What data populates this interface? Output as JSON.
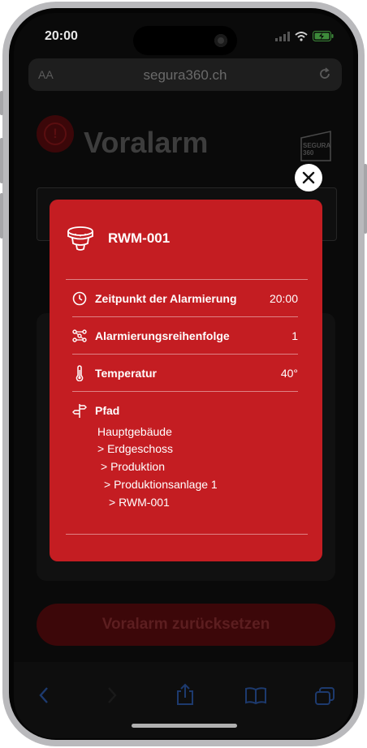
{
  "status_bar": {
    "time": "20:00"
  },
  "browser": {
    "text_size_button": "AA",
    "url": "segura360.ch"
  },
  "page": {
    "title": "Voralarm",
    "logo_text": [
      "SEGURA",
      "360"
    ],
    "reset_button": "Voralarm zurücksetzen"
  },
  "modal": {
    "device_name": "RWM-001",
    "rows": [
      {
        "label": "Zeitpunkt der Alarmierung",
        "value": "20:00",
        "icon": "clock-icon"
      },
      {
        "label": "Alarmierungsreihenfolge",
        "value": "1",
        "icon": "sequence-icon"
      },
      {
        "label": "Temperatur",
        "value": "40°",
        "icon": "thermometer-icon"
      },
      {
        "label": "Pfad",
        "value": "",
        "icon": "signpost-icon"
      }
    ],
    "path": [
      "Hauptgebäude",
      "> Erdgeschoss",
      "> Produktion",
      "> Produktionsanlage 1",
      "> RWM-001"
    ]
  },
  "colors": {
    "modal_red": "#c41d22",
    "dim_red": "#3c0709",
    "backdrop": "#0a0a0a"
  }
}
